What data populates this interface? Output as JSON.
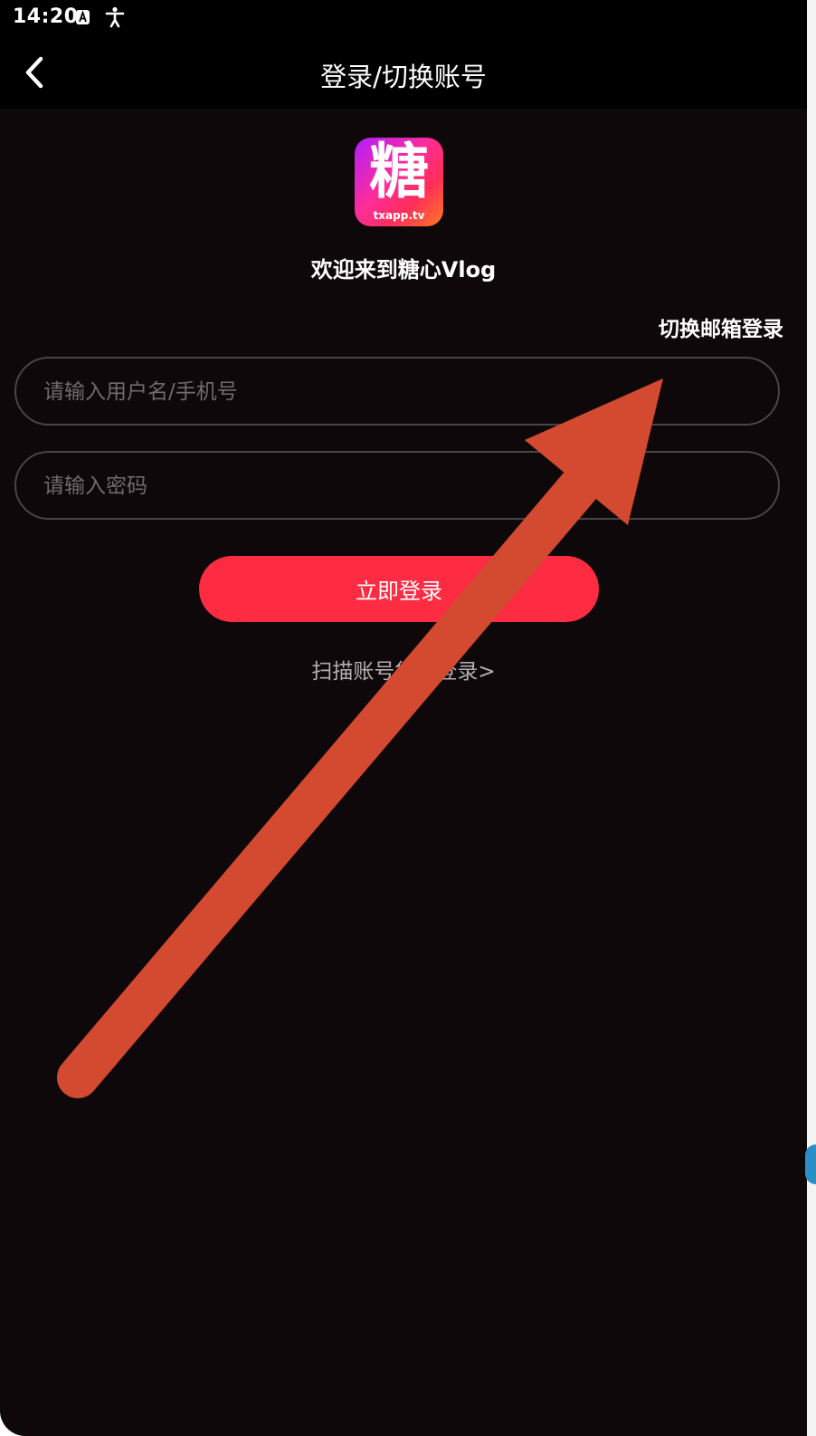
{
  "status_bar": {
    "time": "14:20",
    "icons": [
      "font-icon",
      "accessibility-icon"
    ]
  },
  "header": {
    "title": "登录/切换账号",
    "back_icon": "chevron-left-icon"
  },
  "brand": {
    "logo_char": "糖",
    "logo_sub": "txapp.tv",
    "welcome": "欢迎来到糖心Vlog"
  },
  "form": {
    "switch_email": "切换邮箱登录",
    "username_placeholder": "请输入用户名/手机号",
    "password_placeholder": "请输入密码",
    "login_button": "立即登录",
    "scan_link": "扫描账号凭证登录>"
  },
  "annotation": {
    "type": "arrow",
    "color": "#d44a30",
    "points_to": "switch-email-link"
  },
  "colors": {
    "background": "#0f080b",
    "accent": "#fd2c43"
  }
}
